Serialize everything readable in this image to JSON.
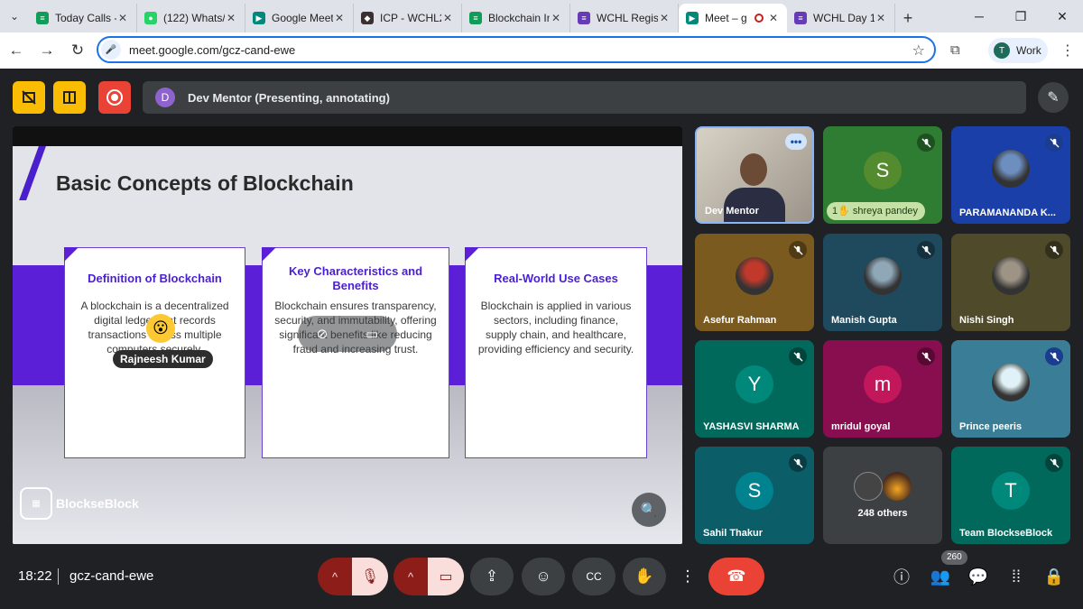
{
  "browser": {
    "tabs": [
      {
        "title": "Today Calls -",
        "icon": "sheets-icon",
        "color": "#0f9d58",
        "glyph": "≡"
      },
      {
        "title": "(122) Whats/",
        "icon": "whatsapp-icon",
        "color": "#25d366",
        "glyph": "●"
      },
      {
        "title": "Google Meet",
        "icon": "meet-icon",
        "color": "#00897b",
        "glyph": "▶"
      },
      {
        "title": "ICP - WCHL2",
        "icon": "icp-icon",
        "color": "#3b2f2f",
        "glyph": "◆"
      },
      {
        "title": "Blockchain In",
        "icon": "sheets-icon",
        "color": "#0f9d58",
        "glyph": "≡"
      },
      {
        "title": "WCHL Regist",
        "icon": "forms-icon",
        "color": "#673ab7",
        "glyph": "≡"
      },
      {
        "title": "Meet – g",
        "icon": "meet-icon",
        "color": "#00897b",
        "glyph": "▶",
        "active": true
      },
      {
        "title": "WCHL Day 1",
        "icon": "forms-icon",
        "color": "#673ab7",
        "glyph": "≡"
      }
    ],
    "url": "meet.google.com/gcz-cand-ewe",
    "profile_label": "Work",
    "profile_initial": "T"
  },
  "meet": {
    "presenter_initial": "D",
    "presenter_text": "Dev Mentor (Presenting, annotating)"
  },
  "slide": {
    "title": "Basic Concepts of Blockchain",
    "cards": [
      {
        "heading": "Definition of Blockchain",
        "body": "A blockchain is a decentralized digital ledger that records transactions across multiple computers securely."
      },
      {
        "heading": "Key Characteristics and Benefits",
        "body": "Blockchain ensures transparency, security, and immutability, offering significant benefits like reducing fraud and increasing trust."
      },
      {
        "heading": "Real-World Use Cases",
        "body": "Blockchain is applied in various sectors, including finance, supply chain, and healthcare, providing efficiency and security."
      }
    ],
    "logo_text": "BlockseBlock",
    "reaction_emoji": "😮",
    "reaction_name": "Rajneesh Kumar"
  },
  "participants": [
    {
      "name": "Dev Mentor",
      "type": "video",
      "bg": "#b9b3a8",
      "speaking": true
    },
    {
      "name": "shreya pandey",
      "type": "initial",
      "initial": "S",
      "bg": "#2e7d32",
      "avatar": "#558b2f",
      "muted": true,
      "hand": "1"
    },
    {
      "name": "PARAMANANDA K...",
      "type": "photo",
      "bg": "#1a3fa8",
      "avatar": "#6d8fbf",
      "muted": true,
      "blue": true
    },
    {
      "name": "Asefur Rahman",
      "type": "photo",
      "bg": "#7a5a1f",
      "avatar": "#c0392b",
      "muted": true
    },
    {
      "name": "Manish Gupta",
      "type": "photo",
      "bg": "#1f4a5e",
      "avatar": "#8fa8b8",
      "muted": true
    },
    {
      "name": "Nishi Singh",
      "type": "photo",
      "bg": "#4e4a2a",
      "avatar": "#9e9486",
      "muted": true
    },
    {
      "name": "YASHASVI SHARMA",
      "type": "initial",
      "initial": "Y",
      "bg": "#00695c",
      "avatar": "#00897b",
      "muted": true
    },
    {
      "name": "mridul goyal",
      "type": "initial",
      "initial": "m",
      "bg": "#880e4f",
      "avatar": "#c2185b",
      "muted": true
    },
    {
      "name": "Prince peeris",
      "type": "photo",
      "bg": "#3a7d96",
      "avatar": "#e0f2f7",
      "muted": true,
      "blue": true
    },
    {
      "name": "Sahil Thakur",
      "type": "initial",
      "initial": "S",
      "bg": "#0b5e68",
      "avatar": "#00838f",
      "muted": true
    },
    {
      "name": "248 others",
      "type": "others",
      "bg": "#3c4043"
    },
    {
      "name": "Team BlockseBlock",
      "type": "initial",
      "initial": "T",
      "bg": "#00695c",
      "avatar": "#00897b",
      "muted": true
    }
  ],
  "bottom": {
    "time": "18:22",
    "meeting_code": "gcz-cand-ewe",
    "people_count": "260"
  }
}
